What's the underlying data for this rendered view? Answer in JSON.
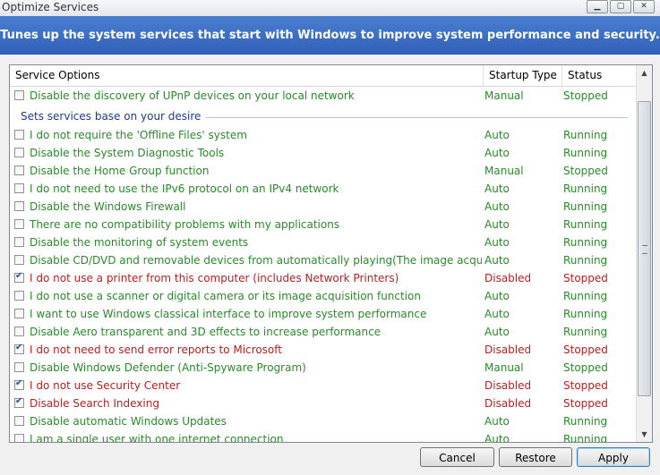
{
  "window": {
    "title": "Optimize Services"
  },
  "banner": {
    "text": "Tunes up the system services that start with Windows to improve system performance and security."
  },
  "columns": {
    "service_options": "Service Options",
    "startup_type": "Startup Type",
    "status": "Status"
  },
  "colors": {
    "enabled_text": "#2a8a2a",
    "changed_text": "#b81f1f",
    "group_label": "#1f3a8a",
    "banner_bg": "#3a6cc4"
  },
  "top_row": {
    "label": "Disable the discovery of UPnP devices on your local network",
    "startup": "Manual",
    "status": "Stopped",
    "checked": false
  },
  "group": {
    "label": "Sets services base on your desire"
  },
  "rows": [
    {
      "label": "I do not require the 'Offline Files' system",
      "startup": "Auto",
      "status": "Running",
      "checked": false
    },
    {
      "label": "Disable the System Diagnostic Tools",
      "startup": "Auto",
      "status": "Running",
      "checked": false
    },
    {
      "label": "Disable the Home Group function",
      "startup": "Manual",
      "status": "Stopped",
      "checked": false
    },
    {
      "label": "I do not need to use the IPv6 protocol on an IPv4 network",
      "startup": "Auto",
      "status": "Running",
      "checked": false
    },
    {
      "label": "Disable the Windows Firewall",
      "startup": "Auto",
      "status": "Running",
      "checked": false
    },
    {
      "label": "There are no compatibility problems with my applications",
      "startup": "Auto",
      "status": "Running",
      "checked": false
    },
    {
      "label": "Disable the monitoring of system events",
      "startup": "Auto",
      "status": "Running",
      "checked": false
    },
    {
      "label": "Disable CD/DVD and removable devices from automatically playing(The image acquisition of...",
      "startup": "Auto",
      "status": "Running",
      "checked": false
    },
    {
      "label": "I do not use a printer from this computer (includes Network Printers)",
      "startup": "Disabled",
      "status": "Stopped",
      "checked": true
    },
    {
      "label": "I do not use a scanner or digital camera or its image acquisition function",
      "startup": "Auto",
      "status": "Running",
      "checked": false
    },
    {
      "label": "I want to use Windows classical interface to improve system performance",
      "startup": "Auto",
      "status": "Running",
      "checked": false
    },
    {
      "label": "Disable Aero transparent and 3D effects to increase performance",
      "startup": "Auto",
      "status": "Running",
      "checked": false
    },
    {
      "label": "I do not need to send error reports to Microsoft",
      "startup": "Disabled",
      "status": "Stopped",
      "checked": true
    },
    {
      "label": "Disable Windows Defender (Anti-Spyware Program)",
      "startup": "Manual",
      "status": "Stopped",
      "checked": false
    },
    {
      "label": "I do not use Security Center",
      "startup": "Disabled",
      "status": "Stopped",
      "checked": true
    },
    {
      "label": "Disable Search Indexing",
      "startup": "Disabled",
      "status": "Stopped",
      "checked": true
    },
    {
      "label": "Disable automatic Windows Updates",
      "startup": "Auto",
      "status": "Running",
      "checked": false
    },
    {
      "label": "I am a single user with one internet connection",
      "startup": "Auto",
      "status": "Running",
      "checked": false
    }
  ],
  "buttons": {
    "cancel": "Cancel",
    "restore": "Restore",
    "apply": "Apply"
  },
  "icons": {
    "minimize": "minimize-icon",
    "maximize": "maximize-icon",
    "close": "close-icon",
    "scroll_up": "arrow-up-icon",
    "scroll_down": "arrow-down-icon"
  }
}
